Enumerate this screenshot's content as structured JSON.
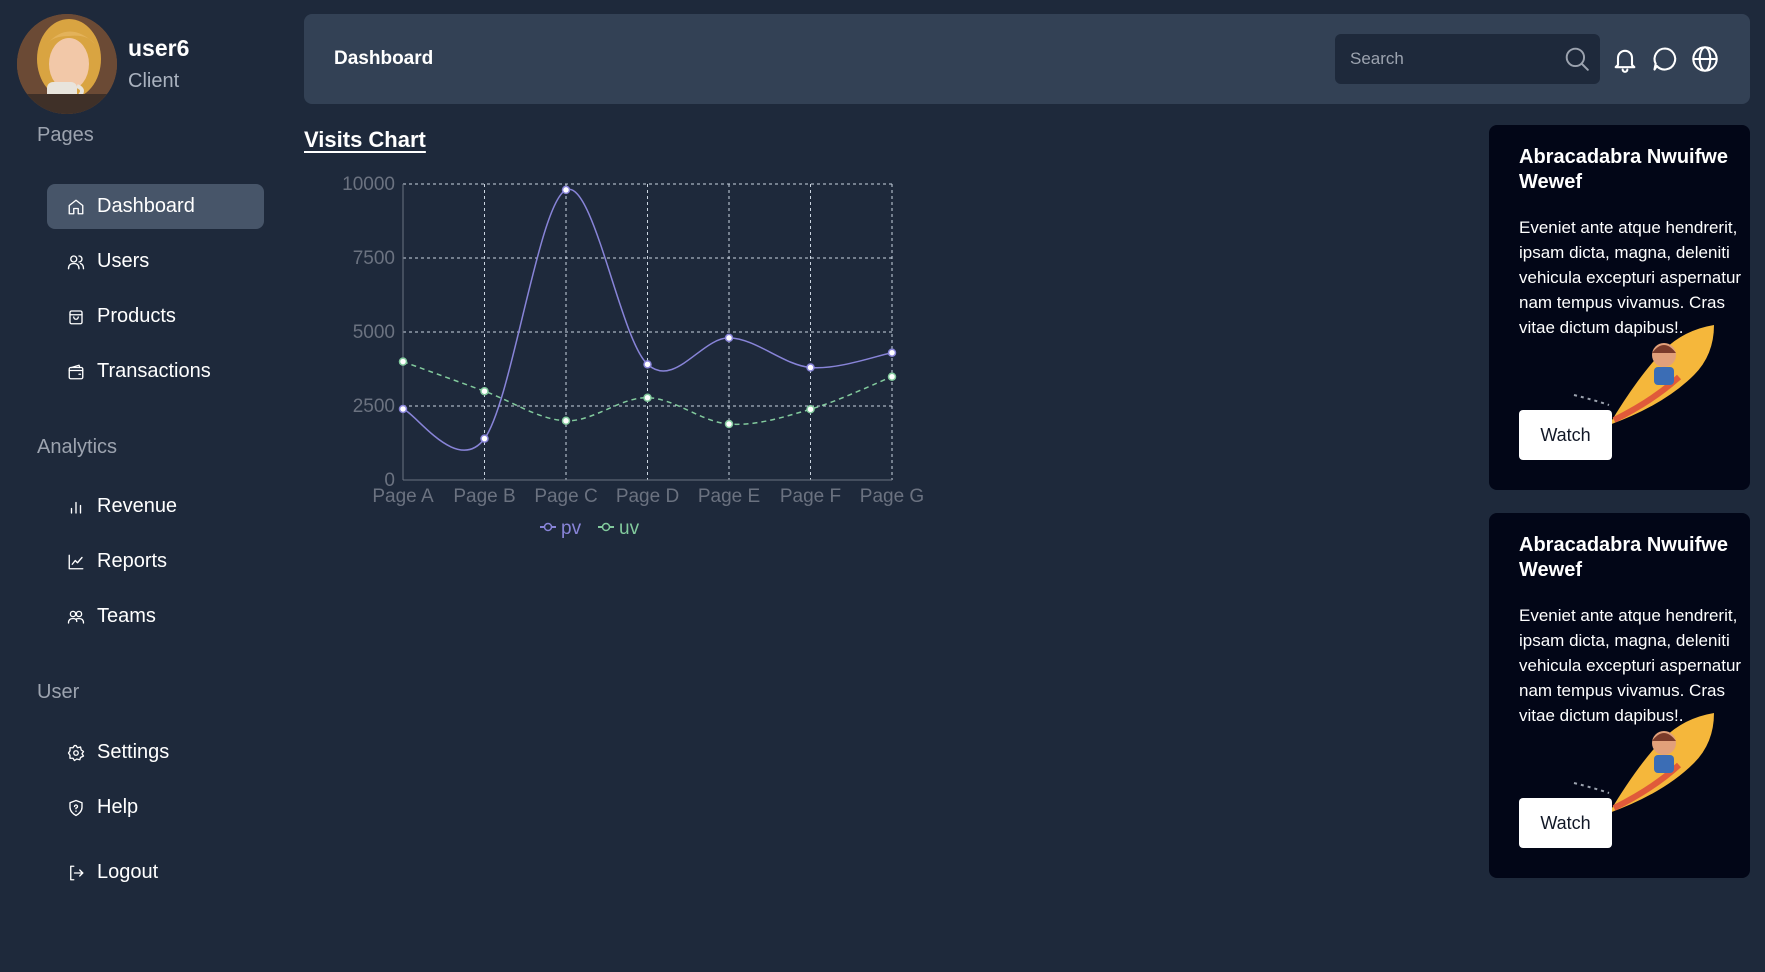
{
  "user": {
    "name": "user6",
    "role": "Client"
  },
  "sidebar": {
    "sections": [
      {
        "title": "Pages",
        "items": [
          {
            "label": "Dashboard",
            "icon": "home-icon",
            "active": true
          },
          {
            "label": "Users",
            "icon": "users-icon"
          },
          {
            "label": "Products",
            "icon": "shopping-bag-icon"
          },
          {
            "label": "Transactions",
            "icon": "wallet-icon"
          }
        ]
      },
      {
        "title": "Analytics",
        "items": [
          {
            "label": "Revenue",
            "icon": "bar-chart-icon"
          },
          {
            "label": "Reports",
            "icon": "line-chart-icon"
          },
          {
            "label": "Teams",
            "icon": "team-icon"
          }
        ]
      },
      {
        "title": "User",
        "items": [
          {
            "label": "Settings",
            "icon": "gear-icon"
          },
          {
            "label": "Help",
            "icon": "shield-help-icon"
          },
          {
            "label": "Logout",
            "icon": "logout-icon"
          }
        ]
      }
    ]
  },
  "header": {
    "title": "Dashboard",
    "search_placeholder": "Search"
  },
  "chart": {
    "title": "Visits Chart"
  },
  "chart_data": {
    "type": "line",
    "categories": [
      "Page A",
      "Page B",
      "Page C",
      "Page D",
      "Page E",
      "Page F",
      "Page G"
    ],
    "ylim": [
      0,
      10000
    ],
    "yticks": [
      0,
      2500,
      5000,
      7500,
      10000
    ],
    "grid": true,
    "legend": "bottom",
    "series": [
      {
        "name": "pv",
        "color": "#8884d8",
        "curve": "smooth",
        "values": [
          2400,
          1398,
          9800,
          3908,
          4800,
          3800,
          4300
        ]
      },
      {
        "name": "uv",
        "color": "#82ca9d",
        "curve": "dashed",
        "values": [
          4000,
          3000,
          2000,
          2780,
          1890,
          2390,
          3490
        ]
      }
    ]
  },
  "cards": [
    {
      "title": "Abracadabra Nwuifwe Wewef",
      "text": "Eveniet ante atque hendrerit, ipsam dicta, magna, deleniti vehicula excepturi aspernatur nam tempus vivamus. Cras vitae dictum dapibus!.",
      "button": "Watch"
    },
    {
      "title": "Abracadabra Nwuifwe Wewef",
      "text": "Eveniet ante atque hendrerit, ipsam dicta, magna, deleniti vehicula excepturi aspernatur nam tempus vivamus. Cras vitae dictum dapibus!.",
      "button": "Watch"
    }
  ]
}
